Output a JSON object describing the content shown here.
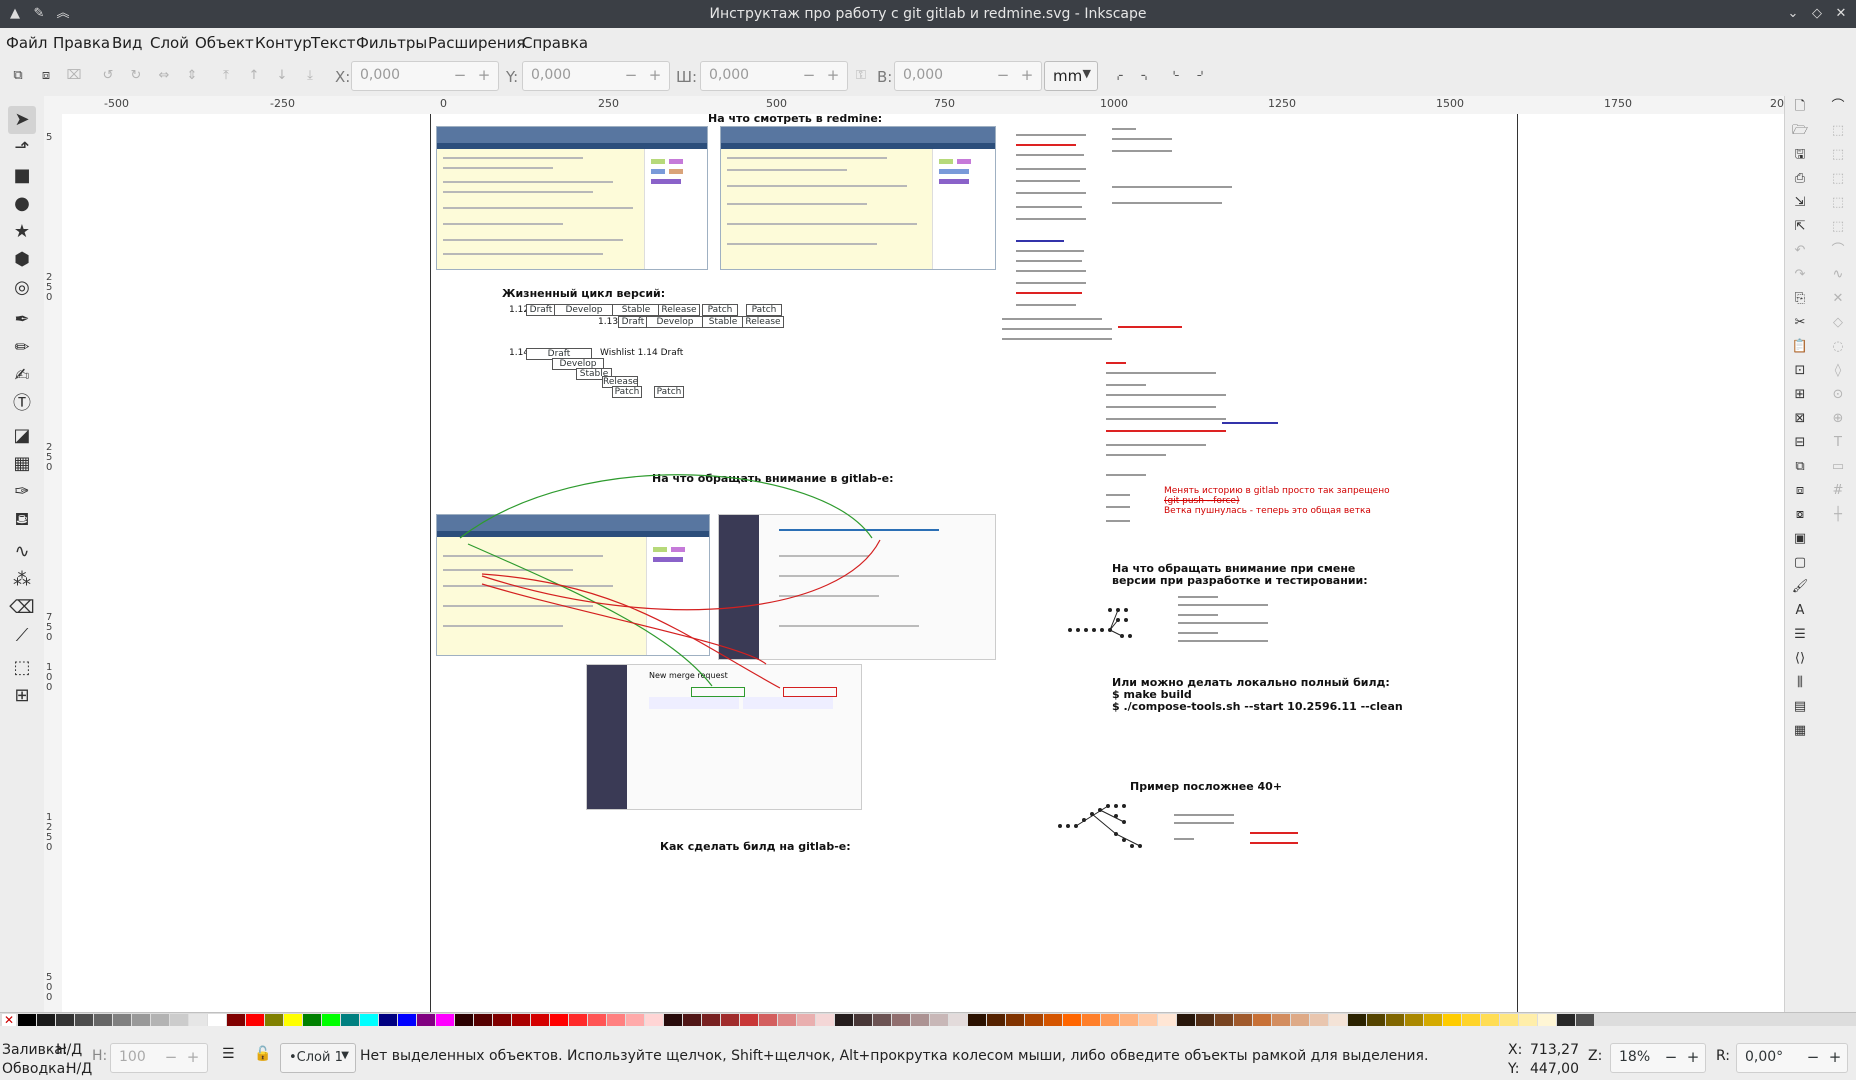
{
  "window": {
    "title": "Инструктаж про работу с git gitlab и redmine.svg - Inkscape",
    "app_icon": "inkscape-icon",
    "pin_icon": "pin-icon",
    "collapse_icon": "chevron-up-icon",
    "buttons": {
      "minimize": "⌄",
      "maximize": "◇",
      "close": "✕"
    }
  },
  "menu": {
    "items": [
      {
        "label": "Файл"
      },
      {
        "label": "Правка"
      },
      {
        "label": "Вид"
      },
      {
        "label": "Слой"
      },
      {
        "label": "Объект"
      },
      {
        "label": "Контур"
      },
      {
        "label": "Текст"
      },
      {
        "label": "Фильтры"
      },
      {
        "label": "Расширения"
      },
      {
        "label": "Справка"
      }
    ]
  },
  "controls": {
    "x_label": "X:",
    "x_value": "0,000",
    "y_label": "Y:",
    "y_value": "0,000",
    "w_label": "Ш:",
    "w_value": "0,000",
    "h_label": "В:",
    "h_value": "0,000",
    "unit": "mm",
    "minus": "−",
    "plus": "+"
  },
  "ruler": {
    "h_labels": [
      "-500",
      "-250",
      "0",
      "250",
      "500",
      "750",
      "1000",
      "1250",
      "1500",
      "1750",
      "2000"
    ],
    "v_labels": [
      "5",
      "2",
      "5",
      "0",
      "2",
      "5",
      "0",
      "7",
      "5",
      "0",
      "1",
      "0",
      "0",
      "1",
      "2",
      "5",
      "0",
      "5",
      "0",
      "0",
      "7",
      "5"
    ]
  },
  "canvas": {
    "section_redmine": "На что смотреть в redmine:",
    "lifecycle_title": "Жизненный цикл версий:",
    "v112": "1.12",
    "v113": "1.13",
    "v114": "1.14",
    "draft": "Draft",
    "develop": "Develop",
    "stable": "Stable",
    "release": "Release",
    "patch": "Patch",
    "wishlist": "Wishlist 1.14 Draft",
    "section_gitlab": "На что обращать внимание в gitlab-е:",
    "change_version_l1": "На что обращать внимание при смене",
    "change_version_l2": "версии при разработке и тестировании:",
    "local_build_l1": "Или можно делать локально полный билд:",
    "local_build_l2": "$ make build",
    "local_build_l3": "$ ./compose-tools.sh --start 10.2596.11 --clean",
    "example_40": "Пример посложнее 40+",
    "gitlab_build": "Как сделать билд на gitlab-е:",
    "red_note_l1": "Менять историю в gitlab просто так запрещено",
    "red_note_l2": "(git push --force)",
    "red_note_l3": "Ветка пушнулась - теперь это общая ветка",
    "mr_title": "New merge request"
  },
  "colors": {
    "redmine_header": "#5876a0",
    "redmine_nav": "#2c4e7b",
    "redmine_bg": "#fdfbd9",
    "arrow_green": "#2e9b2e",
    "arrow_red": "#d42020"
  },
  "status": {
    "fill_label": "Заливка:",
    "fill_value": "Н/Д",
    "stroke_label": "Обводка:",
    "stroke_value": "Н/Д",
    "opacity_label": "Н:",
    "opacity_value": "100",
    "layer": "•Слой 1",
    "message": "Нет выделенных объектов. Используйте щелчок, Shift+щелчок, Alt+прокрутка колесом мыши, либо обведите объекты рамкой для выделения.",
    "x_label": "X:",
    "x_value": "713,27",
    "y_label": "Y:",
    "y_value": "447,00",
    "zoom_label": "Z:",
    "zoom_value": "18%",
    "rotate_label": "R:",
    "rotate_value": "0,00°"
  }
}
